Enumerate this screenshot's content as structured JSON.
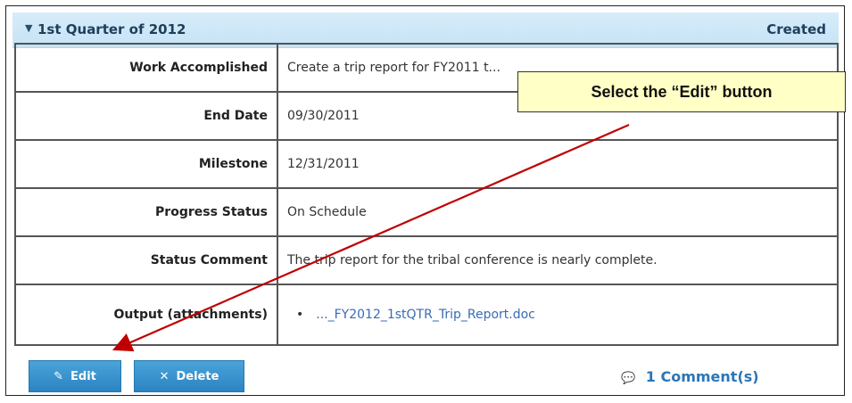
{
  "header": {
    "title": "1st Quarter of 2012",
    "status": "Created",
    "collapse_icon": "chevron-down-icon"
  },
  "details": [
    {
      "label": "Work Accomplished",
      "value": "Create a trip report for FY2011 t..."
    },
    {
      "label": "End Date",
      "value": "09/30/2011"
    },
    {
      "label": "Milestone",
      "value": "12/31/2011"
    },
    {
      "label": "Progress Status",
      "value": "On Schedule"
    },
    {
      "label": "Status Comment",
      "value": "The trip report for the tribal conference is nearly complete."
    },
    {
      "label": "Output (attachments)",
      "value": "..._FY2012_1stQTR_Trip_Report.doc"
    }
  ],
  "buttons": {
    "edit": {
      "label": "Edit",
      "icon": "pencil-icon"
    },
    "delete": {
      "label": "Delete",
      "icon": "x-icon"
    }
  },
  "comments": {
    "label": "1 Comment(s)",
    "icon": "comment-icon"
  },
  "callout": {
    "text": "Select the “Edit” button"
  },
  "colors": {
    "header_bg": "#c6e3f6",
    "button_blue": "#2b84c2",
    "link": "#3a6bb5",
    "callout_bg": "#ffffc6",
    "arrow": "#c00000"
  }
}
